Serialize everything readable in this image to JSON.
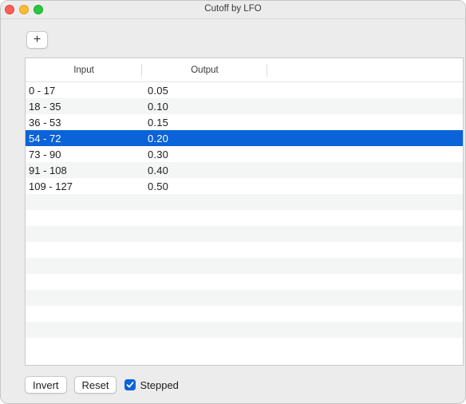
{
  "window": {
    "title": "Cutoff by LFO"
  },
  "toolbar": {
    "add_label": "+"
  },
  "table": {
    "columns": [
      "Input",
      "Output"
    ],
    "rows": [
      {
        "input": "0 - 17",
        "output": "0.05"
      },
      {
        "input": "18 - 35",
        "output": "0.10"
      },
      {
        "input": "36 - 53",
        "output": "0.15"
      },
      {
        "input": "54 - 72",
        "output": "0.20"
      },
      {
        "input": "73 - 90",
        "output": "0.30"
      },
      {
        "input": "91 - 108",
        "output": "0.40"
      },
      {
        "input": "109 - 127",
        "output": "0.50"
      }
    ],
    "selected_row": "54 - 72"
  },
  "footer": {
    "invert_label": "Invert",
    "reset_label": "Reset",
    "stepped_label": "Stepped",
    "stepped_checked": true
  },
  "colors": {
    "selection": "#0a63d8",
    "close": "#fe5f57",
    "minimize": "#febc2e",
    "maximize": "#28c840"
  }
}
